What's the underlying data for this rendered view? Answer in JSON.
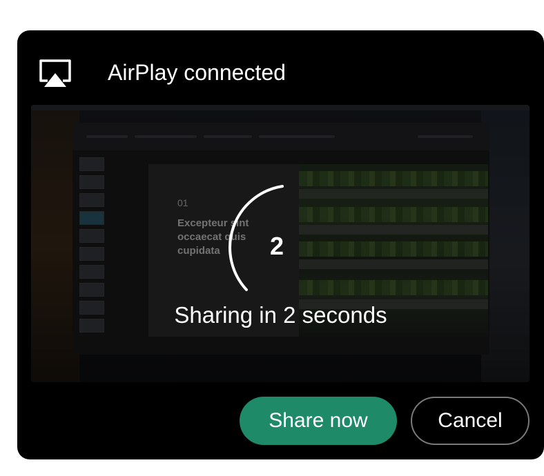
{
  "dialog": {
    "title": "AirPlay connected",
    "icon": "airplay-icon",
    "countdown": "2",
    "status": "Sharing in 2 seconds",
    "share_label": "Share now",
    "cancel_label": "Cancel"
  },
  "preview": {
    "slide_number": "01",
    "slide_text": "Excepteur sint occaecat quis cupidata"
  },
  "colors": {
    "dialog_bg": "#000000",
    "accent": "#1e8a68",
    "cancel_border": "#7a7a7a",
    "text": "#ffffff"
  }
}
